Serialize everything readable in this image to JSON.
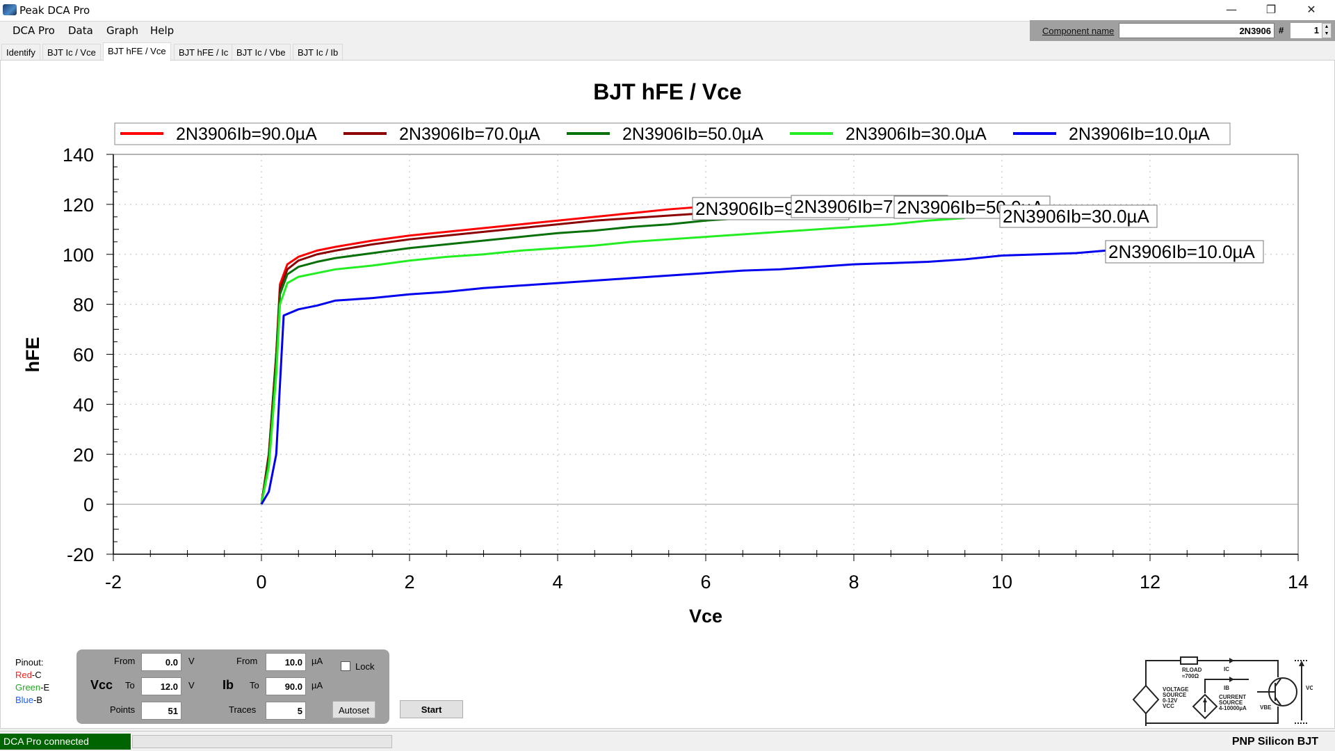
{
  "window": {
    "title": "Peak DCA Pro",
    "controls": [
      "minimize",
      "maximize",
      "close"
    ]
  },
  "menu": [
    "DCA Pro",
    "Data",
    "Graph",
    "Help"
  ],
  "component": {
    "label": "Component name",
    "value": "2N3906",
    "hash": "#",
    "number": "1"
  },
  "tabs": [
    {
      "label": "Identify",
      "active": false
    },
    {
      "label": "BJT Ic / Vce",
      "active": false
    },
    {
      "label": "BJT hFE / Vce",
      "active": true
    },
    {
      "label": "BJT hFE / Ic",
      "active": false
    },
    {
      "label": "BJT Ic / Vbe",
      "active": false
    },
    {
      "label": "BJT Ic / Ib",
      "active": false
    }
  ],
  "chart_data": {
    "type": "line",
    "title": "BJT hFE / Vce",
    "xlabel": "Vce",
    "ylabel": "hFE",
    "xlim": [
      -2,
      14
    ],
    "ylim": [
      -20,
      140
    ],
    "xticks": [
      -2,
      0,
      2,
      4,
      6,
      8,
      10,
      12,
      14
    ],
    "yticks": [
      -20,
      0,
      20,
      40,
      60,
      80,
      100,
      120,
      140
    ],
    "grid": true,
    "legend_position": "top",
    "series": [
      {
        "name": "2N3906Ib=90.0µA",
        "color": "#ff0000",
        "end_label": "2N3906Ib=9",
        "x": [
          0,
          0.1,
          0.2,
          0.25,
          0.35,
          0.5,
          0.75,
          1.0,
          1.5,
          2.0,
          2.5,
          3.0,
          3.5,
          4.0,
          4.5,
          5.0,
          5.5,
          5.85
        ],
        "y": [
          0,
          20,
          60,
          88,
          96,
          99,
          101.5,
          103,
          105.5,
          107.5,
          109,
          110.5,
          112,
          113.5,
          115,
          116.5,
          118,
          118.8
        ]
      },
      {
        "name": "2N3906Ib=70.0µA",
        "color": "#8b0000",
        "end_label": "2N3906Ib=7",
        "x": [
          0,
          0.1,
          0.2,
          0.25,
          0.35,
          0.5,
          0.75,
          1.0,
          1.5,
          2.0,
          2.5,
          3.0,
          3.5,
          4.0,
          4.5,
          5.0,
          5.5,
          6.0,
          6.5,
          7.0
        ],
        "y": [
          0,
          20,
          60,
          86,
          94,
          97.5,
          100,
          101.5,
          104,
          106,
          107.5,
          109,
          110.5,
          112,
          113.5,
          114.5,
          115.5,
          116.5,
          117.5,
          118.5
        ]
      },
      {
        "name": "2N3906Ib=50.0µA",
        "color": "#087008",
        "end_label": "2N3906Ib=50.0µA",
        "x": [
          0,
          0.1,
          0.2,
          0.25,
          0.35,
          0.5,
          0.75,
          1.0,
          1.5,
          2.0,
          2.5,
          3.0,
          3.5,
          4.0,
          4.5,
          5.0,
          5.5,
          6.0,
          6.5,
          7.0,
          7.5,
          8.0,
          8.5,
          9.0
        ],
        "y": [
          0,
          18,
          58,
          84,
          92,
          95,
          97,
          98.5,
          100.5,
          102.5,
          104,
          105.5,
          107,
          108.5,
          109.5,
          111,
          112,
          113.5,
          114.5,
          115.5,
          116.5,
          117.5,
          118.5,
          119
        ]
      },
      {
        "name": "2N3906Ib=30.0µA",
        "color": "#22ee22",
        "end_label": "2N3906Ib=30.0µA",
        "x": [
          0,
          0.1,
          0.2,
          0.25,
          0.35,
          0.5,
          0.75,
          1.0,
          1.5,
          2.0,
          2.5,
          3.0,
          3.5,
          4.0,
          4.5,
          5.0,
          5.5,
          6.0,
          6.5,
          7.0,
          7.5,
          8.0,
          8.5,
          9.0,
          9.5
        ],
        "y": [
          0,
          15,
          52,
          80,
          88.5,
          91,
          92.5,
          94,
          95.5,
          97.5,
          99,
          100,
          101.5,
          102.5,
          103.5,
          105,
          106,
          107,
          108,
          109,
          110,
          111,
          112,
          113.5,
          114.5
        ]
      },
      {
        "name": "2N3906Ib=10.0µA",
        "color": "#0000ee",
        "end_label": "2N3906Ib=10.0µA",
        "x": [
          0,
          0.1,
          0.2,
          0.3,
          0.5,
          0.75,
          1.0,
          1.5,
          2.0,
          2.5,
          3.0,
          3.5,
          4.0,
          4.5,
          5.0,
          5.5,
          6.0,
          6.5,
          7.0,
          7.5,
          8.0,
          8.5,
          9.0,
          9.5,
          10.0,
          10.5,
          11.0,
          11.4
        ],
        "y": [
          0,
          5,
          20,
          75.5,
          78,
          79.5,
          81.5,
          82.5,
          84,
          85,
          86.5,
          87.5,
          88.5,
          89.5,
          90.5,
          91.5,
          92.5,
          93.5,
          94,
          95,
          96,
          96.5,
          97,
          98,
          99.5,
          100,
          100.5,
          101.5
        ]
      }
    ]
  },
  "pinout": {
    "label": "Pinout:",
    "pins": [
      {
        "color_name": "Red",
        "pin": "-C",
        "color": "#ff2020"
      },
      {
        "color_name": "Green",
        "pin": "-E",
        "color": "#22aa22"
      },
      {
        "color_name": "Blue",
        "pin": "-B",
        "color": "#2060ff"
      }
    ]
  },
  "controls": {
    "vcc": {
      "label": "Vcc",
      "from_label": "From",
      "from": "0.0",
      "to_label": "To",
      "to": "12.0",
      "unit": "V"
    },
    "ib": {
      "label": "Ib",
      "from_label": "From",
      "from": "10.0",
      "to_label": "To",
      "to": "90.0",
      "unit": "µA"
    },
    "points_label": "Points",
    "points": "51",
    "traces_label": "Traces",
    "traces": "5",
    "lock_label": "Lock",
    "lock_checked": false,
    "autoset_label": "Autoset",
    "start_label": "Start"
  },
  "schematic": {
    "voltage_source": [
      "VOLTAGE",
      "SOURCE",
      "0-12V",
      "VCC"
    ],
    "rload": "RLOAD",
    "rload_value": "≈700Ω",
    "ic": "IC",
    "ib": "IB",
    "current_source": [
      "CURRENT",
      "SOURCE",
      "4-10000µA"
    ],
    "vbe": "VBE",
    "vce": "VCE"
  },
  "status": {
    "connection": "DCA Pro connected",
    "progress": 0,
    "device_type": "PNP Silicon BJT"
  }
}
